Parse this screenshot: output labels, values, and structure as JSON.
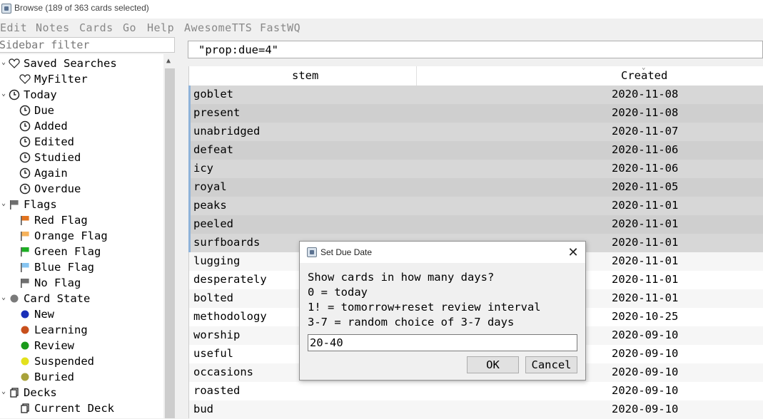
{
  "window": {
    "title": "Browse (189 of 363 cards selected)"
  },
  "menubar": [
    "Edit",
    "Notes",
    "Cards",
    "Go",
    "Help",
    "AwesomeTTS",
    "FastWQ"
  ],
  "sidebar": {
    "filter_placeholder": "Sidebar filter",
    "items": [
      {
        "label": "Saved Searches",
        "icon": "heart-icon",
        "level": 0,
        "arrow": "✓"
      },
      {
        "label": "MyFilter",
        "icon": "heart-icon",
        "level": 1
      },
      {
        "label": "Today",
        "icon": "clock-icon",
        "level": 0,
        "arrow": "✓"
      },
      {
        "label": "Due",
        "icon": "clock-icon",
        "level": 1
      },
      {
        "label": "Added",
        "icon": "clock-icon",
        "level": 1
      },
      {
        "label": "Edited",
        "icon": "clock-icon",
        "level": 1
      },
      {
        "label": "Studied",
        "icon": "clock-icon",
        "level": 1
      },
      {
        "label": "Again",
        "icon": "clock-icon",
        "level": 1
      },
      {
        "label": "Overdue",
        "icon": "clock-icon",
        "level": 1
      },
      {
        "label": "Flags",
        "icon": "flag-icon",
        "level": 0,
        "arrow": "✓",
        "color": "#6f6f6f"
      },
      {
        "label": "Red Flag",
        "icon": "flag-icon",
        "level": 1,
        "color": "#e2731f"
      },
      {
        "label": "Orange Flag",
        "icon": "flag-icon",
        "level": 1,
        "color": "#f6b25a"
      },
      {
        "label": "Green Flag",
        "icon": "flag-icon",
        "level": 1,
        "color": "#1dae24"
      },
      {
        "label": "Blue Flag",
        "icon": "flag-icon",
        "level": 1,
        "color": "#86c4f1"
      },
      {
        "label": "No Flag",
        "icon": "flag-icon",
        "level": 1,
        "color": "#6f6f6f"
      },
      {
        "label": "Card State",
        "icon": "dot-icon",
        "level": 0,
        "arrow": "✓",
        "color": "#7a7a7a"
      },
      {
        "label": "New",
        "icon": "dot-icon",
        "level": 1,
        "color": "#1a2fb8"
      },
      {
        "label": "Learning",
        "icon": "dot-icon",
        "level": 1,
        "color": "#c8501c"
      },
      {
        "label": "Review",
        "icon": "dot-icon",
        "level": 1,
        "color": "#1a9a1a"
      },
      {
        "label": "Suspended",
        "icon": "dot-icon",
        "level": 1,
        "color": "#e3e11c"
      },
      {
        "label": "Buried",
        "icon": "dot-icon",
        "level": 1,
        "color": "#a8a23a"
      },
      {
        "label": "Decks",
        "icon": "deck-icon",
        "level": 0,
        "arrow": "✓"
      },
      {
        "label": "Current Deck",
        "icon": "deck-icon",
        "level": 1
      }
    ]
  },
  "search": {
    "value": "\"prop:due=4\""
  },
  "table": {
    "columns": [
      "stem",
      "Created"
    ],
    "rows": [
      {
        "stem": "goblet",
        "created": "2020-11-08",
        "selected": true
      },
      {
        "stem": "present",
        "created": "2020-11-08",
        "selected": true
      },
      {
        "stem": "unabridged",
        "created": "2020-11-07",
        "selected": true
      },
      {
        "stem": "defeat",
        "created": "2020-11-06",
        "selected": true
      },
      {
        "stem": "icy",
        "created": "2020-11-06",
        "selected": true
      },
      {
        "stem": "royal",
        "created": "2020-11-05",
        "selected": true
      },
      {
        "stem": "peaks",
        "created": "2020-11-01",
        "selected": true
      },
      {
        "stem": "peeled",
        "created": "2020-11-01",
        "selected": true
      },
      {
        "stem": "surfboards",
        "created": "2020-11-01",
        "selected": true
      },
      {
        "stem": "lugging",
        "created": "2020-11-01",
        "selected": false
      },
      {
        "stem": "desperately",
        "created": "2020-11-01",
        "selected": false
      },
      {
        "stem": "bolted",
        "created": "2020-11-01",
        "selected": false
      },
      {
        "stem": "methodology",
        "created": "2020-10-25",
        "selected": false
      },
      {
        "stem": "worship",
        "created": "2020-09-10",
        "selected": false
      },
      {
        "stem": "useful",
        "created": "2020-09-10",
        "selected": false
      },
      {
        "stem": "occasions",
        "created": "2020-09-10",
        "selected": false
      },
      {
        "stem": "roasted",
        "created": "2020-09-10",
        "selected": false
      },
      {
        "stem": "bud",
        "created": "2020-09-10",
        "selected": false
      }
    ]
  },
  "dialog": {
    "title": "Set Due Date",
    "lines": [
      "Show cards in how many days?",
      "0 = today",
      "1! = tomorrow+reset review interval",
      "3-7 = random choice of 3-7 days"
    ],
    "input_value": "20-40",
    "ok_label": "OK",
    "cancel_label": "Cancel"
  }
}
